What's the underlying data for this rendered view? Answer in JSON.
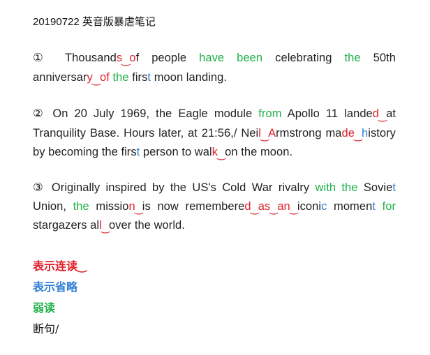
{
  "title": "20190722 英音版暴虐笔记",
  "p1": {
    "num": "①",
    "a": " Thousand",
    "b": "s",
    "c": "‿",
    "d": "o",
    "e": "f people ",
    "f": "have been",
    "g": " celebrating ",
    "h": "the",
    "i": " 50th anniversar",
    "j": "y",
    "k": "‿",
    "l": "of",
    "m": " ",
    "n": "the",
    "o": " firs",
    "p": "t",
    "q": " moon landing."
  },
  "p2": {
    "num": "②",
    "a": " On 20 July 1969, the Eagle module ",
    "b": "from",
    "c": " Apollo 11 lande",
    "d": "d",
    "e": "‿",
    "f": "at Tranquility Base. Hours later, at 21:56,/ Nei",
    "g": "l",
    "h": "‿",
    "i": "A",
    "j": "rmstrong ma",
    "k": "de",
    "l": "‿",
    "m": "h",
    "n": "istory by becoming the firs",
    "o": "t",
    "p": " person to wal",
    "q": "k",
    "r": "‿",
    "s": "on the moon."
  },
  "p3": {
    "num": "③",
    "a": " Originally inspired by the US's Cold War rivalry ",
    "b": "with the",
    "c": " Sovie",
    "d": "t",
    "e": " Union, ",
    "f": "the",
    "g": " missio",
    "h": "n",
    "i": "‿",
    "j": "is now remembere",
    "k": "d",
    "l": "‿",
    "m": "as",
    "n": "‿",
    "o": "an",
    "p": "‿",
    "q": "iconi",
    "r": "c",
    "s": " momen",
    "t": "t",
    "u": " ",
    "v": "for",
    "w": " stargazers al",
    "x": "l",
    "y": "‿",
    "z": "over the world."
  },
  "legend": {
    "linking": "表示连读‿",
    "elision": "表示省略",
    "weak": "弱读",
    "pause": "断句/"
  },
  "colors": {
    "linking": "#e0202a",
    "elision": "#2f7fd6",
    "weak": "#1fb14b",
    "text": "#222222"
  }
}
